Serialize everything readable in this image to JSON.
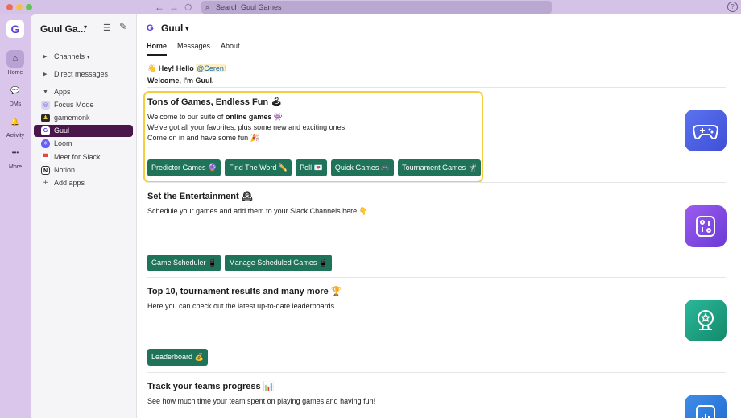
{
  "window": {
    "search_placeholder": "Search Guul Games",
    "back_icon": "←",
    "forward_icon": "→",
    "history_icon": "⏱",
    "help_icon": "?"
  },
  "rail": {
    "workspace_initial": "G",
    "items": [
      {
        "label": "Home",
        "icon": "home-icon",
        "glyph": "⌂"
      },
      {
        "label": "DMs",
        "icon": "dms-icon",
        "glyph": "💬"
      },
      {
        "label": "Activity",
        "icon": "bell-icon",
        "glyph": "🔔"
      },
      {
        "label": "More",
        "icon": "more-icon",
        "glyph": "•••"
      }
    ]
  },
  "sidebar": {
    "workspace_name": "Guul Ga...",
    "sections": {
      "channels": "Channels",
      "direct_messages": "Direct messages",
      "apps": "Apps",
      "add_apps": "Add apps"
    },
    "apps": [
      {
        "label": "Focus Mode"
      },
      {
        "label": "gamemonk"
      },
      {
        "label": "Guul"
      },
      {
        "label": "Loom"
      },
      {
        "label": "Meet for Slack"
      },
      {
        "label": "Notion"
      }
    ]
  },
  "app": {
    "name": "Guul",
    "tabs": [
      "Home",
      "Messages",
      "About"
    ],
    "greeting": {
      "wave": "👋",
      "text": "Hey! Hello ",
      "mention": "@Ceren",
      "suffix": "!",
      "line2": "Welcome, I'm Guul."
    },
    "sections": [
      {
        "title": "Tons of Games, Endless Fun 🕹",
        "line1_pre": "Welcome to our suite of ",
        "line1_bold": "online games",
        "line1_post": " 👾",
        "line2": "We've got all your favorites, plus some new and exciting ones!",
        "line3": "Come on in and have some fun 🎉",
        "buttons": [
          "Predictor Games 🔮",
          "Find The Word ✏️",
          "Poll 💌",
          "Quick Games 🎮",
          "Tournament Games 🤺"
        ]
      },
      {
        "title": "Set the Entertainment 🕰",
        "line1": "Schedule your games and add them to your Slack Channels here 👇",
        "buttons": [
          "Game Scheduler 📱",
          "Manage Scheduled Games 📱"
        ]
      },
      {
        "title": "Top 10, tournament results and many more 🏆",
        "line1": "Here you can check out the latest up-to-date leaderboards",
        "buttons": [
          "Leaderboard 💰"
        ]
      },
      {
        "title": "Track your teams progress 📊",
        "line1": "See how much time your team spent on playing games and having fun!"
      }
    ]
  },
  "colors": {
    "button_green": "#1f7358",
    "highlight": "#f5cc42",
    "selected_item": "#4a154b",
    "rail_bg": "#d9c6ea"
  }
}
